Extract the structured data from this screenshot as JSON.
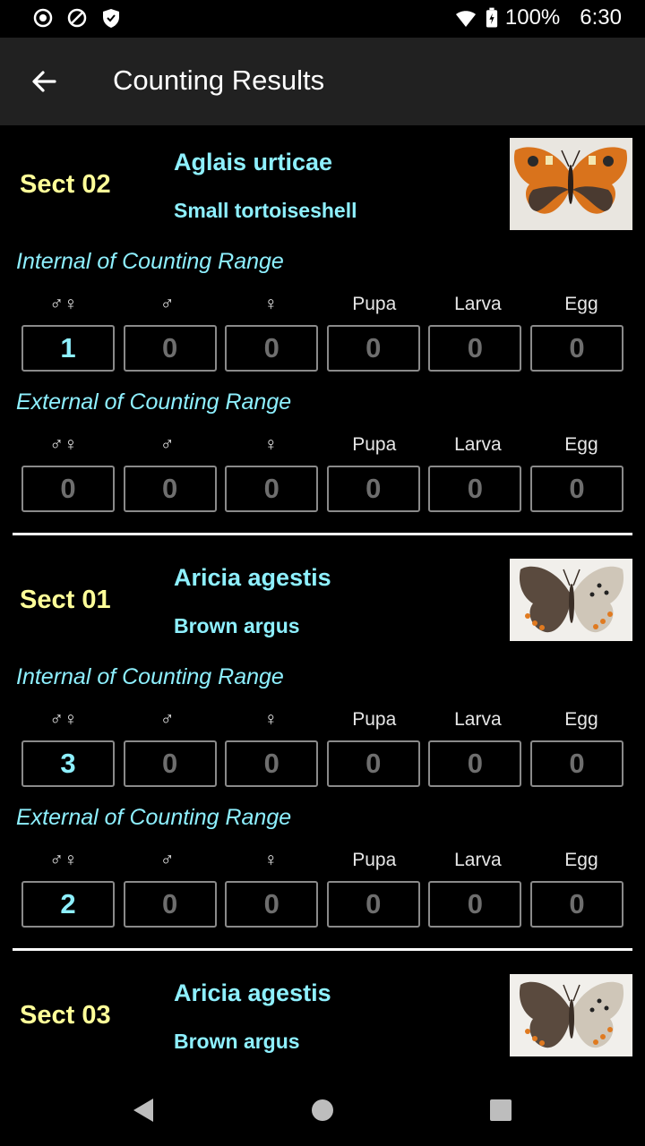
{
  "status_bar": {
    "battery": "100%",
    "time": "6:30",
    "icons": [
      "record-icon",
      "do-not-disturb-icon",
      "shield-icon",
      "wifi-icon",
      "battery-charging-icon"
    ]
  },
  "app_bar": {
    "title": "Counting Results",
    "back_icon": "arrow-left-icon"
  },
  "column_labels": [
    "♂♀",
    "♂",
    "♀",
    "Pupa",
    "Larva",
    "Egg"
  ],
  "cards": [
    {
      "section": "Sect 02",
      "scientific_name": "Aglais urticae",
      "common_name": "Small tortoiseshell",
      "internal": {
        "title": "Internal of Counting Range",
        "values": [
          "1",
          "0",
          "0",
          "0",
          "0",
          "0"
        ]
      },
      "external": {
        "title": "External of Counting Range",
        "values": [
          "0",
          "0",
          "0",
          "0",
          "0",
          "0"
        ]
      }
    },
    {
      "section": "Sect 01",
      "scientific_name": "Aricia agestis",
      "common_name": "Brown argus",
      "internal": {
        "title": "Internal of Counting Range",
        "values": [
          "3",
          "0",
          "0",
          "0",
          "0",
          "0"
        ]
      },
      "external": {
        "title": "External of Counting Range",
        "values": [
          "2",
          "0",
          "0",
          "0",
          "0",
          "0"
        ]
      }
    },
    {
      "section": "Sect 03",
      "scientific_name": "Aricia agestis",
      "common_name": "Brown argus"
    }
  ],
  "nav_bar": {
    "icons": [
      "back-triangle-icon",
      "home-circle-icon",
      "recents-square-icon"
    ]
  },
  "colors": {
    "section": "#ffff99",
    "species": "#8ef0ff",
    "appbar": "#212121",
    "inactive_value": "#6e6e6e"
  }
}
